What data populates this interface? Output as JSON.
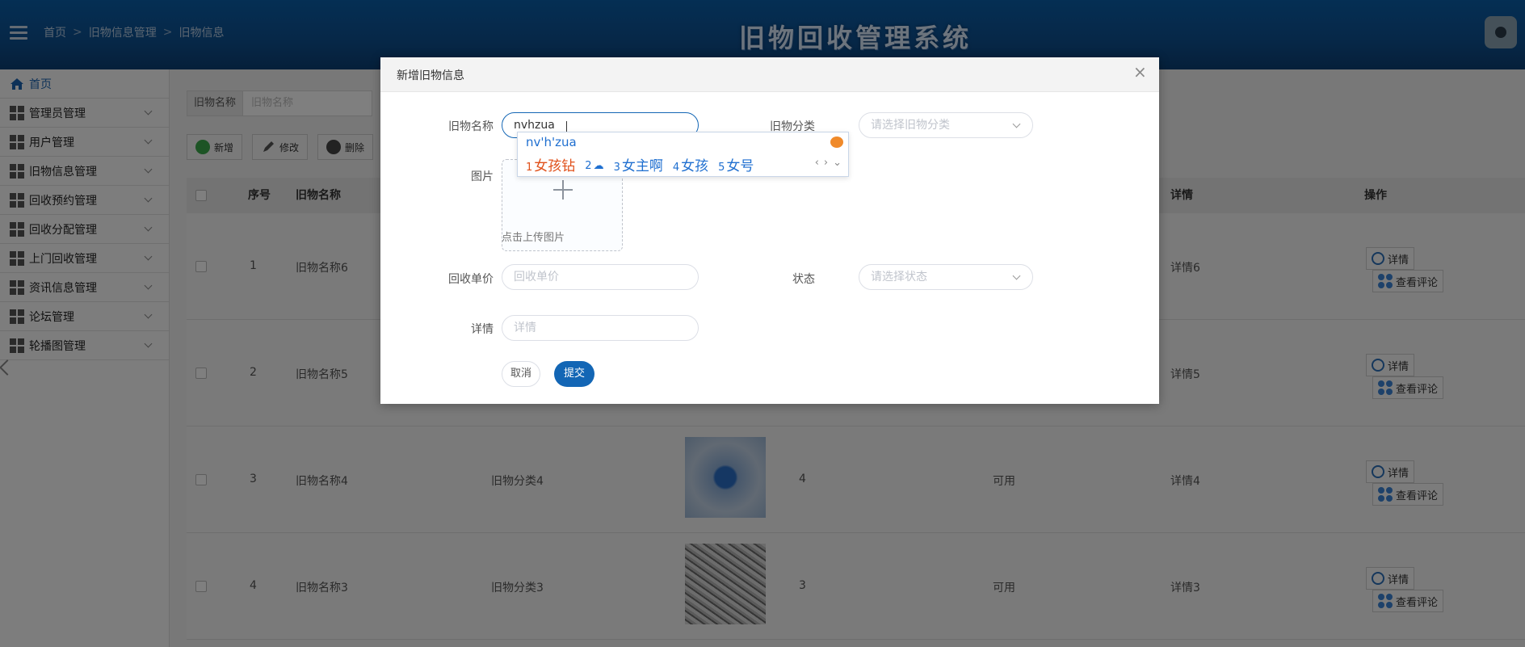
{
  "header": {
    "breadcrumb": [
      "首页",
      "旧物信息管理",
      "旧物信息"
    ],
    "system_title": "旧物回收管理系统"
  },
  "sidebar": {
    "items": [
      {
        "label": "首页"
      },
      {
        "label": "管理员管理"
      },
      {
        "label": "用户管理"
      },
      {
        "label": "旧物信息管理"
      },
      {
        "label": "回收预约管理"
      },
      {
        "label": "回收分配管理"
      },
      {
        "label": "上门回收管理"
      },
      {
        "label": "资讯信息管理"
      },
      {
        "label": "论坛管理"
      },
      {
        "label": "轮播图管理"
      }
    ]
  },
  "search": {
    "label": "旧物名称",
    "placeholder": "旧物名称"
  },
  "toolbar": {
    "add": "新增",
    "edit": "修改",
    "delete": "删除"
  },
  "table": {
    "headers": {
      "index": "序号",
      "name": "旧物名称",
      "detail": "详情",
      "action": "操作"
    },
    "rows": [
      {
        "index": "1",
        "name": "旧物名称6",
        "category": "",
        "price": "",
        "status": "",
        "detail": "详情6"
      },
      {
        "index": "2",
        "name": "旧物名称5",
        "category": "",
        "price": "",
        "status": "",
        "detail": "详情5"
      },
      {
        "index": "3",
        "name": "旧物名称4",
        "category": "旧物分类4",
        "price": "4",
        "status": "可用",
        "detail": "详情4"
      },
      {
        "index": "4",
        "name": "旧物名称3",
        "category": "旧物分类3",
        "price": "3",
        "status": "可用",
        "detail": "详情3"
      }
    ],
    "detail_btn": "详情",
    "comment_btn": "查看评论"
  },
  "dialog": {
    "title": "新增旧物信息",
    "fields": {
      "name_label": "旧物名称",
      "name_value": "nvhzua",
      "category_label": "旧物分类",
      "category_placeholder": "请选择旧物分类",
      "image_label": "图片",
      "upload_tip": "点击上传图片",
      "price_label": "回收单价",
      "price_placeholder": "回收单价",
      "status_label": "状态",
      "status_placeholder": "请选择状态",
      "detail_label": "详情",
      "detail_placeholder": "详情"
    },
    "cancel": "取消",
    "submit": "提交"
  },
  "ime": {
    "composition": "nv'h'zua",
    "candidates": [
      {
        "n": "1",
        "text": "女孩钻"
      },
      {
        "n": "2",
        "text": ""
      },
      {
        "n": "3",
        "text": "女主啊"
      },
      {
        "n": "4",
        "text": "女孩"
      },
      {
        "n": "5",
        "text": "女号"
      }
    ]
  }
}
